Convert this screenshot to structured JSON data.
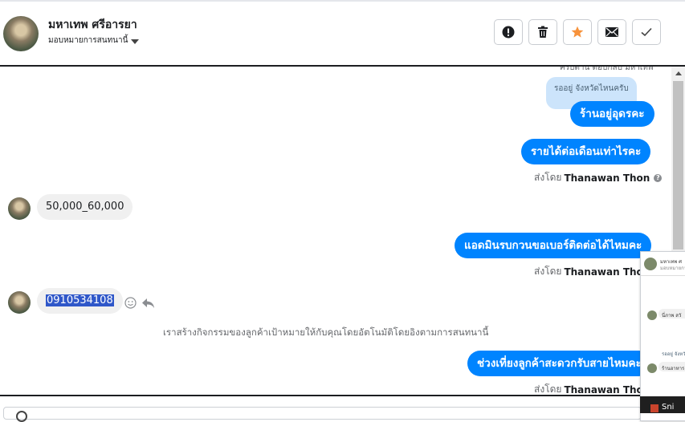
{
  "header": {
    "contact_name": "มหาเทพ ศรีอารยา",
    "assign_label": "มอบหมายการสนทนานี้"
  },
  "toolbar": {
    "icons": [
      "alert-icon",
      "trash-icon",
      "star-icon",
      "mail-icon",
      "check-icon"
    ],
    "star_color": "#f7923b"
  },
  "colors": {
    "outgoing_bubble": "#0084ff",
    "incoming_bubble": "#f0f0f0",
    "quote_bubble": "#cce4fb",
    "selection": "#2f57c9"
  },
  "messages": {
    "clipped_top_text": "ครับตาน ตอบกลบ มหาเทพ",
    "quoted_reply": "รออยู่ จังหวัดไหนครับ",
    "out_1": "ร้านอยู่อุดรคะ",
    "out_2": "รายได้ต่อเดือนเท่าไรคะ",
    "sent_by_prefix": "ส่งโดย",
    "sent_by_name": "Thanawan Thon",
    "in_1": "50,000_60,000",
    "out_3": "แอดมินรบกวนขอเบอร์ติดต่อได้ไหมคะ",
    "in_2": "0910534108",
    "system_note": "เราสร้างกิจกรรมของลูกค้าเป้าหมายให้กับคุณโดยอัตโนมัติโดยอิงตามการสนทนานี้",
    "out_4": "ช่วงเที่ยงลูกค้าสะดวกรับสายไหมคะ"
  },
  "popup": {
    "name": "มหาเทพ ศ",
    "sub": "มอบหมายการ",
    "line_1": "นี่ภาพ สวั",
    "quote": "รออยู่ จังหวั",
    "line_2": "ร้านอาหาร"
  },
  "taskbar": {
    "label": "Sni"
  }
}
